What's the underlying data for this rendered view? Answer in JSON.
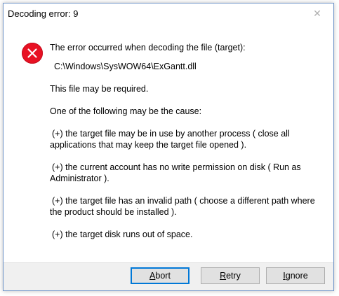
{
  "window": {
    "title": "Decoding error: 9",
    "close_glyph": "✕"
  },
  "message": {
    "main": "The error occurred when decoding the file (target):",
    "path": "C:\\Windows\\SysWOW64\\ExGantt.dll",
    "required": "This file may be required.",
    "cause_intro": "One of the following may be the cause:",
    "causes": [
      {
        "marker": "(+)",
        "text": "the target file may be in use by another process ( close all applications that may keep the target file opened )."
      },
      {
        "marker": "(+)",
        "text": "the current account has no write permission on disk ( Run as Administrator )."
      },
      {
        "marker": "(+)",
        "text": "the target file has an invalid path ( choose a different path where the product should be installed )."
      },
      {
        "marker": "(+)",
        "text": "the target disk runs out of space."
      }
    ]
  },
  "buttons": {
    "abort": {
      "mnemonic": "A",
      "rest": "bort"
    },
    "retry": {
      "mnemonic": "R",
      "rest": "etry"
    },
    "ignore": {
      "mnemonic": "I",
      "rest": "gnore"
    }
  },
  "icons": {
    "error": "error-x-circle",
    "close": "close-x"
  },
  "colors": {
    "error_red": "#e81123",
    "default_button_border": "#0078d7",
    "footer_bg": "#f0f0f0"
  }
}
